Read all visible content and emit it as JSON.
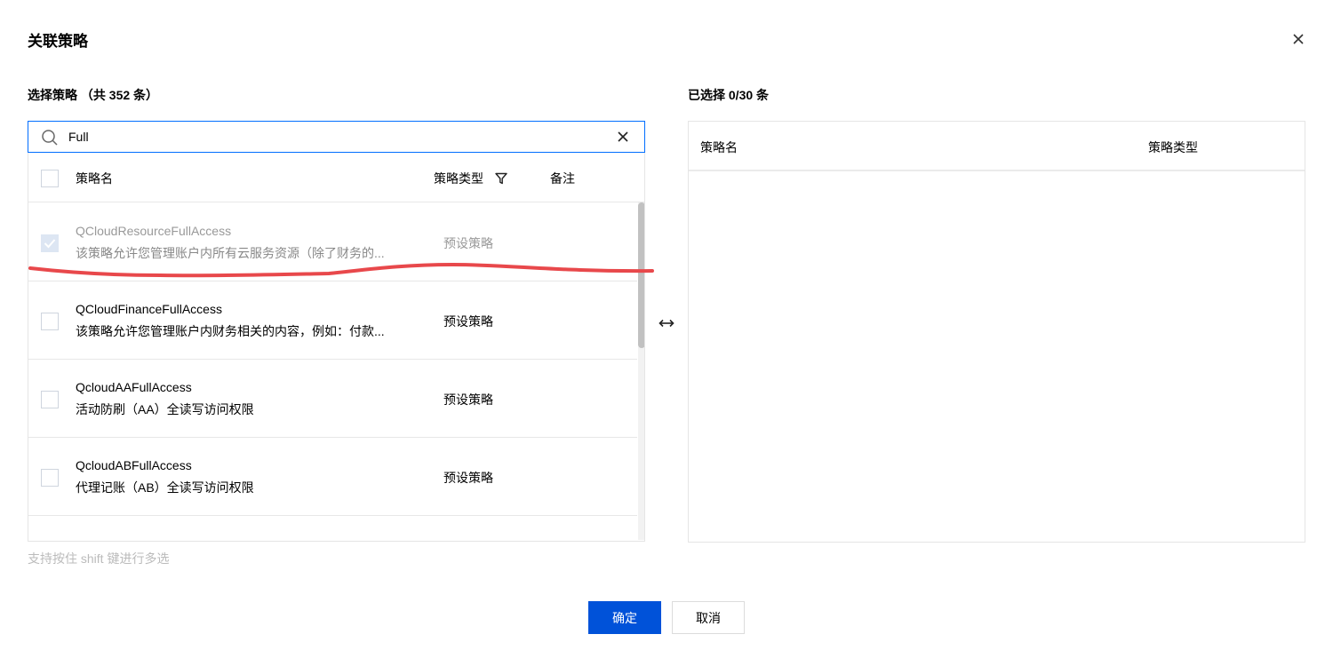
{
  "dialog": {
    "title": "关联策略",
    "close_icon": "close-icon",
    "confirm_label": "确定",
    "cancel_label": "取消"
  },
  "left": {
    "title": "选择策略 （共 352 条）",
    "search": {
      "value": "Full",
      "placeholder": ""
    },
    "columns": {
      "name": "策略名",
      "type": "策略类型",
      "remark": "备注"
    },
    "rows": [
      {
        "name": "QCloudResourceFullAccess",
        "desc": "该策略允许您管理账户内所有云服务资源（除了财务的...",
        "type": "预设策略",
        "checked": true,
        "disabled": true
      },
      {
        "name": "QCloudFinanceFullAccess",
        "desc": "该策略允许您管理账户内财务相关的内容，例如：付款...",
        "type": "预设策略",
        "checked": false,
        "disabled": false
      },
      {
        "name": "QcloudAAFullAccess",
        "desc": "活动防刷（AA）全读写访问权限",
        "type": "预设策略",
        "checked": false,
        "disabled": false
      },
      {
        "name": "QcloudABFullAccess",
        "desc": "代理记账（AB）全读写访问权限",
        "type": "预设策略",
        "checked": false,
        "disabled": false
      }
    ],
    "hint": "支持按住 shift 键进行多选"
  },
  "right": {
    "title": "已选择 0/30 条",
    "columns": {
      "name": "策略名",
      "type": "策略类型"
    }
  },
  "colors": {
    "primary": "#0052d9",
    "focus_border": "#006eff",
    "annotation": "#e8484b"
  }
}
